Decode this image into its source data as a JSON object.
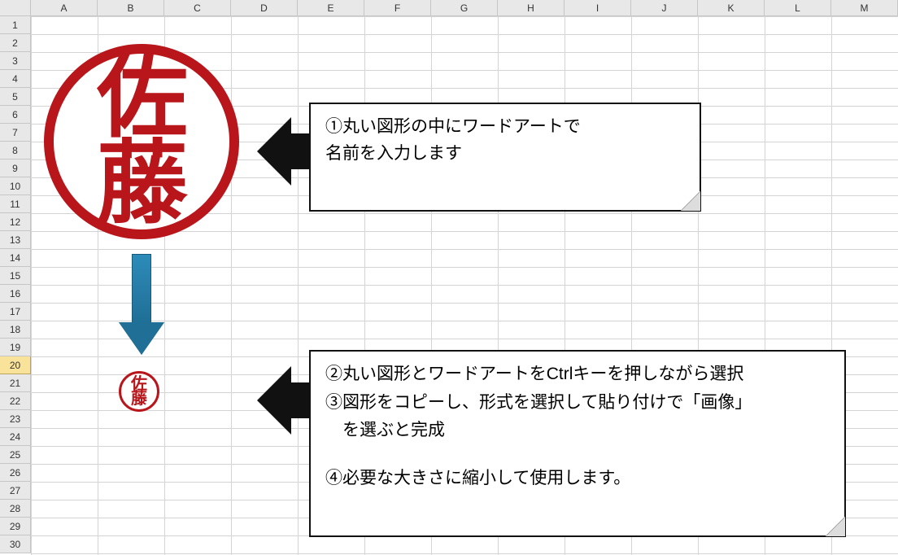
{
  "columns": [
    "A",
    "B",
    "C",
    "D",
    "E",
    "F",
    "G",
    "H",
    "I",
    "J",
    "K",
    "L",
    "M"
  ],
  "rows": [
    "1",
    "2",
    "3",
    "4",
    "5",
    "6",
    "7",
    "8",
    "9",
    "10",
    "11",
    "12",
    "13",
    "14",
    "15",
    "16",
    "17",
    "18",
    "19",
    "20",
    "21",
    "22",
    "23",
    "24",
    "25",
    "26",
    "27",
    "28",
    "29",
    "30"
  ],
  "selected_row_index": 19,
  "stamp": {
    "line1": "佐",
    "line2": "藤"
  },
  "stamp_small": {
    "line1": "佐",
    "line2": "藤"
  },
  "callout1": {
    "line1": "①丸い図形の中にワードアートで",
    "line2": "名前を入力します"
  },
  "callout2": {
    "line1": "②丸い図形とワードアートをCtrlキーを押しながら選択",
    "line2": "③図形をコピーし、形式を選択して貼り付けで「画像」",
    "line3": "　を選ぶと完成",
    "line4": "④必要な大きさに縮小して使用します。"
  },
  "colors": {
    "stamp": "#b8161b",
    "arrow_down": "#1f6f96",
    "arrow_black": "#111111"
  }
}
